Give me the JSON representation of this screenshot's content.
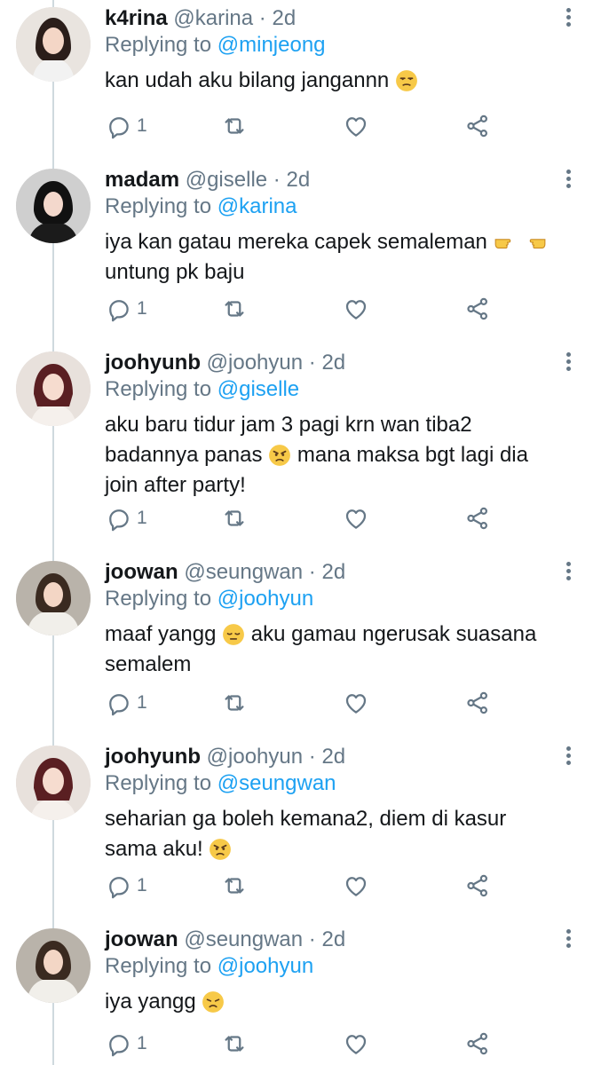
{
  "colors": {
    "accent": "#1da1f2",
    "muted": "#657786",
    "text": "#14171a",
    "thread_line": "#cfd9de"
  },
  "icons": {
    "reply": "reply-icon",
    "retweet": "retweet-icon",
    "like": "heart-icon",
    "share": "share-icon",
    "more": "more-vertical-icon"
  },
  "tweets": [
    {
      "name": "k4rina",
      "handle": "@karina",
      "sep": "·",
      "time": "2d",
      "reply_prefix": "Replying to ",
      "reply_to": "@minjeong",
      "lines": [
        "kan udah aku bilang jangannn"
      ],
      "reply_count": "1"
    },
    {
      "name": "madam",
      "handle": "@giselle",
      "sep": "·",
      "time": "2d",
      "reply_prefix": "Replying to ",
      "reply_to": "@karina",
      "lines": [
        "iya kan gatau mereka capek semaleman",
        "untung pk baju"
      ],
      "reply_count": "1"
    },
    {
      "name": "joohyunb",
      "handle": "@joohyun",
      "sep": "·",
      "time": "2d",
      "reply_prefix": "Replying to ",
      "reply_to": "@giselle",
      "lines": [
        "aku baru tidur jam 3 pagi krn wan tiba2",
        "badannya panas",
        "mana maksa bgt lagi dia",
        "join after party!"
      ],
      "reply_count": "1"
    },
    {
      "name": "joowan",
      "handle": "@seungwan",
      "sep": "·",
      "time": "2d",
      "reply_prefix": "Replying to ",
      "reply_to": "@joohyun",
      "lines": [
        "maaf yangg",
        "aku gamau ngerusak suasana",
        "semalem"
      ],
      "reply_count": "1"
    },
    {
      "name": "joohyunb",
      "handle": "@joohyun",
      "sep": "·",
      "time": "2d",
      "reply_prefix": "Replying to ",
      "reply_to": "@seungwan",
      "lines": [
        "seharian ga boleh kemana2, diem di kasur",
        "sama aku!"
      ],
      "reply_count": "1"
    },
    {
      "name": "joowan",
      "handle": "@seungwan",
      "sep": "·",
      "time": "2d",
      "reply_prefix": "Replying to ",
      "reply_to": "@joohyun",
      "lines": [
        "iya yangg"
      ],
      "reply_count": "1"
    }
  ]
}
